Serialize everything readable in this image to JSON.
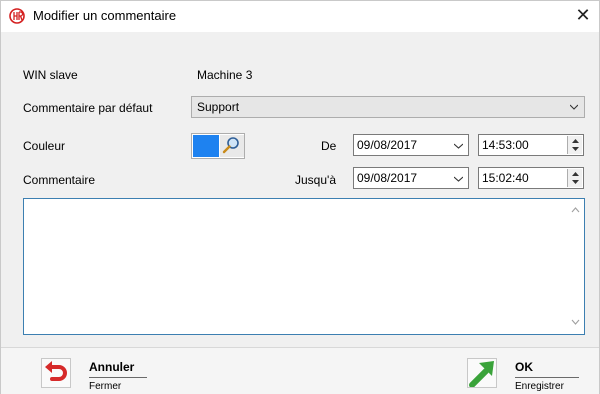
{
  "window": {
    "title": "Modifier un commentaire",
    "close_glyph": "✕",
    "app_icon": "red-circle-hr-icon"
  },
  "form": {
    "win_slave_label": "WIN slave",
    "win_slave_value": "Machine 3",
    "default_comment_label": "Commentaire par défaut",
    "default_comment_value": "Support",
    "color_label": "Couleur",
    "color_value": "#1e82f0",
    "from_label": "De",
    "from_date": "09/08/2017",
    "from_time": "14:53:00",
    "to_label": "Jusqu'à",
    "to_date": "09/08/2017",
    "to_time": "15:02:40",
    "comment_label": "Commentaire",
    "comment_text": ""
  },
  "footer": {
    "cancel_title": "Annuler",
    "cancel_sub": "Fermer",
    "ok_title": "OK",
    "ok_sub": "Enregistrer"
  }
}
